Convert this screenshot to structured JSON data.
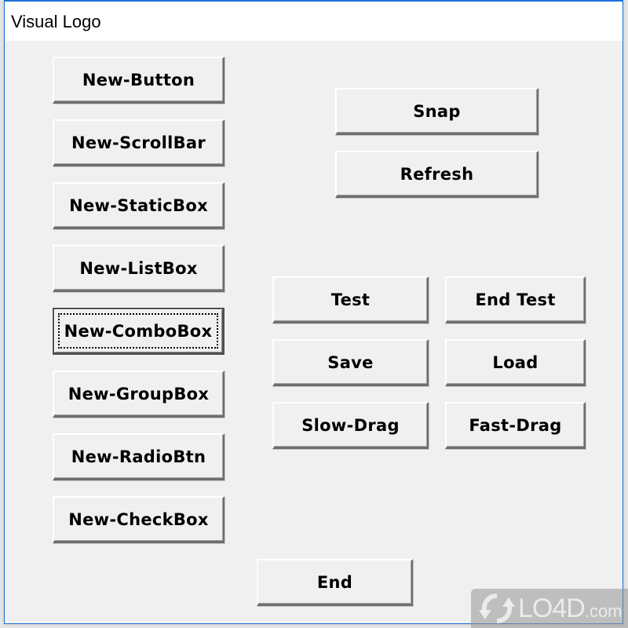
{
  "window": {
    "title": "Visual Logo",
    "accent_color": "#1c6fd8"
  },
  "left_buttons": [
    {
      "label": "New-Button"
    },
    {
      "label": "New-ScrollBar"
    },
    {
      "label": "New-StaticBox"
    },
    {
      "label": "New-ListBox"
    },
    {
      "label": "New-ComboBox",
      "focused": true
    },
    {
      "label": "New-GroupBox"
    },
    {
      "label": "New-RadioBtn"
    },
    {
      "label": "New-CheckBox"
    }
  ],
  "right_top_buttons": {
    "snap": "Snap",
    "refresh": "Refresh"
  },
  "right_grid_buttons": {
    "test": "Test",
    "end_test": "End Test",
    "save": "Save",
    "load": "Load",
    "slow_drag": "Slow-Drag",
    "fast_drag": "Fast-Drag"
  },
  "bottom": {
    "end": "End"
  },
  "watermark": {
    "main": "LO4D",
    "suffix": ".com"
  }
}
